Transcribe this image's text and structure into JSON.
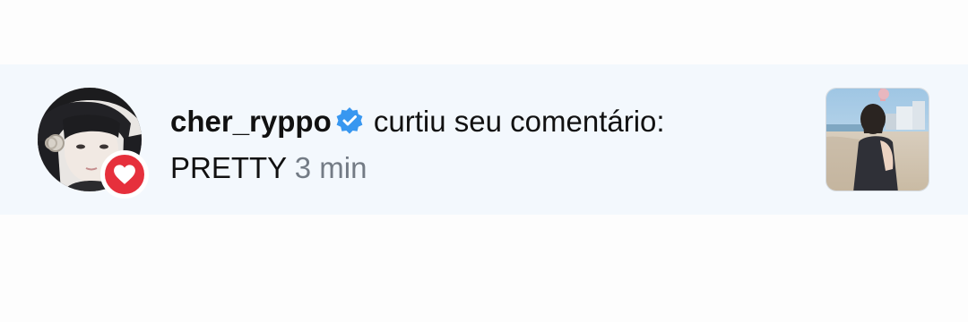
{
  "notification": {
    "username": "cher_ryppo",
    "verified": true,
    "action": "curtiu seu comentário:",
    "comment": "PRETTY",
    "time": "3 min"
  },
  "icons": {
    "verified_badge": "verified-badge-icon",
    "like_badge": "heart-icon"
  },
  "colors": {
    "like_badge": "#e6303c",
    "verified": "#3897f0",
    "row_highlight": "#f3f8fd",
    "time_text": "#737b85"
  }
}
